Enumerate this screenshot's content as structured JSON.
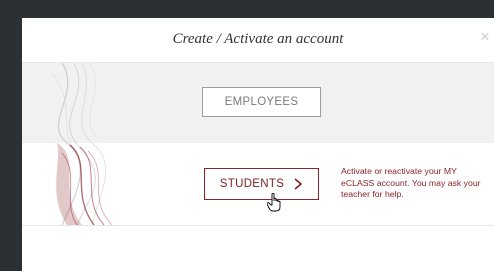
{
  "modal": {
    "title": "Create / Activate an account",
    "close_icon": "close-icon"
  },
  "employees": {
    "label": "EMPLOYEES"
  },
  "students": {
    "label": "STUDENTS",
    "chevron_icon": "chevron-right-icon",
    "help_text": "Activate or reactivate your MY eCLASS account. You may ask your teacher for help."
  },
  "colors": {
    "accent": "#8b2328",
    "band": "#f1f1f1",
    "backdrop": "#2b3035"
  }
}
